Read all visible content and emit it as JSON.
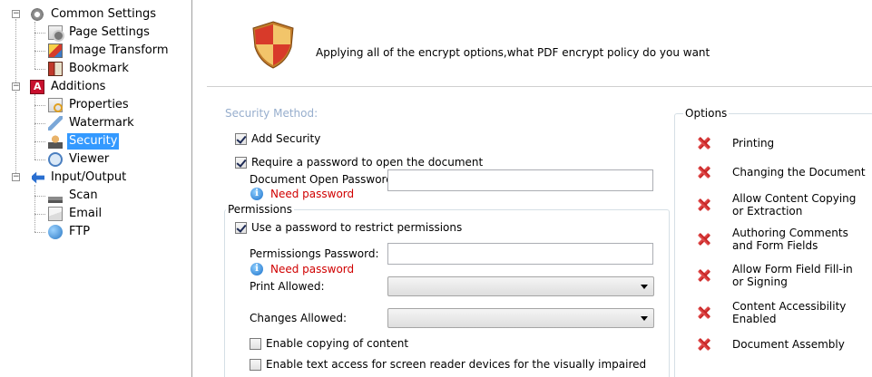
{
  "tree": {
    "items": [
      {
        "label": "Common Settings",
        "icon": "gear-icon"
      },
      {
        "label": "Page Settings",
        "icon": "page-settings-icon"
      },
      {
        "label": "Image Transform",
        "icon": "image-icon"
      },
      {
        "label": "Bookmark",
        "icon": "bookmark-icon"
      },
      {
        "label": "Additions",
        "icon": "pdf-icon"
      },
      {
        "label": "Properties",
        "icon": "properties-icon"
      },
      {
        "label": "Watermark",
        "icon": "watermark-icon"
      },
      {
        "label": "Security",
        "icon": "security-icon",
        "selected": true
      },
      {
        "label": "Viewer",
        "icon": "viewer-icon"
      },
      {
        "label": "Input/Output",
        "icon": "arrow-icon"
      },
      {
        "label": "Scan",
        "icon": "scanner-icon"
      },
      {
        "label": "Email",
        "icon": "email-icon"
      },
      {
        "label": "FTP",
        "icon": "globe-icon"
      }
    ],
    "selection_color": "#3399ff"
  },
  "header": {
    "headline": "Applying all of the encrypt options,what PDF encrypt policy do you want",
    "icon": "shield-icon"
  },
  "security": {
    "method_label": "Security Method:",
    "add_security": {
      "label": "Add Security",
      "checked": true
    },
    "require_open_password": {
      "label": "Require a password to open the document",
      "checked": true
    },
    "open_password_label": "Document Open Password",
    "open_password_value": "",
    "open_password_warning": "Need password"
  },
  "permissions": {
    "title": "Permissions",
    "use_password": {
      "label": "Use a password to restrict permissions",
      "checked": true
    },
    "password_label": "Permissiongs Password:",
    "password_value": "",
    "password_warning": "Need password",
    "print_label": "Print Allowed:",
    "print_value": "",
    "changes_label": "Changes Allowed:",
    "changes_value": "",
    "enable_copying": {
      "label": "Enable copying of content",
      "checked": false
    },
    "enable_text_access": {
      "label": "Enable text access for screen reader devices for the visually impaired",
      "checked": false
    }
  },
  "options": {
    "title": "Options",
    "items": [
      {
        "label": "Printing",
        "state": "denied"
      },
      {
        "label": "Changing the Document",
        "state": "denied"
      },
      {
        "label": "Allow Content Copying\nor Extraction",
        "state": "denied"
      },
      {
        "label": "Authoring Comments\nand Form Fields",
        "state": "denied"
      },
      {
        "label": "Allow Form Field Fill-in\nor Signing",
        "state": "denied"
      },
      {
        "label": "Content Accessibility\nEnabled",
        "state": "denied"
      },
      {
        "label": "Document Assembly",
        "state": "denied"
      }
    ],
    "denied_color": "#d42020"
  }
}
